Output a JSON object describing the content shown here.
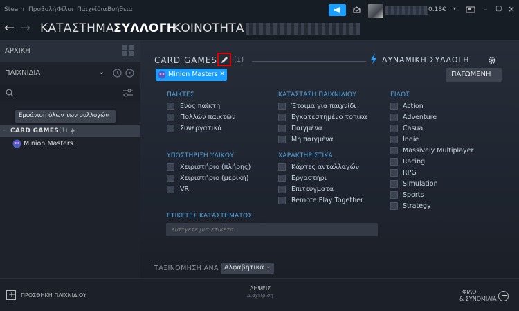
{
  "menubar": {
    "items": [
      "Steam",
      "Προβολή",
      "Φίλοι",
      "Παιχνίδια",
      "Βοήθεια"
    ],
    "balance": "0.18€"
  },
  "nav": {
    "store": "ΚΑΤΑΣΤΗΜΑ",
    "library": "ΣΥΛΛΟΓΗ",
    "community": "ΚΟΙΝΟΤΗΤΑ"
  },
  "sidebar": {
    "home": "ΑΡΧΙΚΗ",
    "filter": "ΠΑΙΧΝΙΔΙΑ",
    "tooltip": "Εμφάνιση όλων των συλλογών",
    "collection": "CARD GAMES",
    "collection_count": "(1)",
    "game": "Minion Masters"
  },
  "collection": {
    "name": "CARD GAMES",
    "count": "(1)",
    "dynamic": "ΔΥΝΑΜΙΚΗ ΣΥΛΛΟΓΗ",
    "frozen": "ΠΑΓΩΜΕΝΗ",
    "tag": "Minion Masters",
    "tag_close": "×"
  },
  "filters": {
    "players": {
      "header": "ΠΑΙΚΤΕΣ",
      "options": [
        "Ενός παίκτη",
        "Πολλών παικτών",
        "Συνεργατικά"
      ]
    },
    "hardware": {
      "header": "ΥΠΟΣΤΗΡΙΞΗ ΥΛΙΚΟΥ",
      "options": [
        "Χειριστήριο (πλήρης)",
        "Χειριστήριο (μερική)",
        "VR"
      ]
    },
    "state": {
      "header": "ΚΑΤΑΣΤΑΣΗ ΠΑΙΧΝΙΔΙΟΥ",
      "options": [
        "Έτοιμα για παιχνίδι",
        "Εγκατεστημένο τοπικά",
        "Παιγμένα",
        "Μη παιγμένα"
      ]
    },
    "features": {
      "header": "ΧΑΡΑΚΤΗΡΙΣΤΙΚΑ",
      "options": [
        "Κάρτες ανταλλαγών",
        "Εργαστήρι",
        "Επιτεύγματα",
        "Remote Play Together"
      ]
    },
    "genre": {
      "header": "ΕΙΔΟΣ",
      "options": [
        "Action",
        "Adventure",
        "Casual",
        "Indie",
        "Massively Multiplayer",
        "Racing",
        "RPG",
        "Simulation",
        "Sports",
        "Strategy"
      ]
    },
    "store_tags": {
      "header": "ΕΤΙΚΕΤΕΣ ΚΑΤΑΣΤΗΜΑΤΟΣ",
      "placeholder": "εισάγετε μια ετικέτα"
    }
  },
  "sort": {
    "label": "ΤΑΞΙΝΟΜΗΣΗ ΑΝΑ",
    "value": "Αλφαβητικά"
  },
  "bottom": {
    "add_game": "ΠΡΟΣΘΗΚΗ ΠΑΙΧΝΙΔΙΟΥ",
    "downloads": "ΛΗΨΕΙΣ",
    "manage": "Διαχείριση",
    "friends1": "ΦΙΛΟΙ",
    "friends2": "& ΣΥΝΟΜΙΛΙΑ"
  },
  "colors": {
    "accent": "#1a9fff",
    "highlight": "#e00000"
  }
}
